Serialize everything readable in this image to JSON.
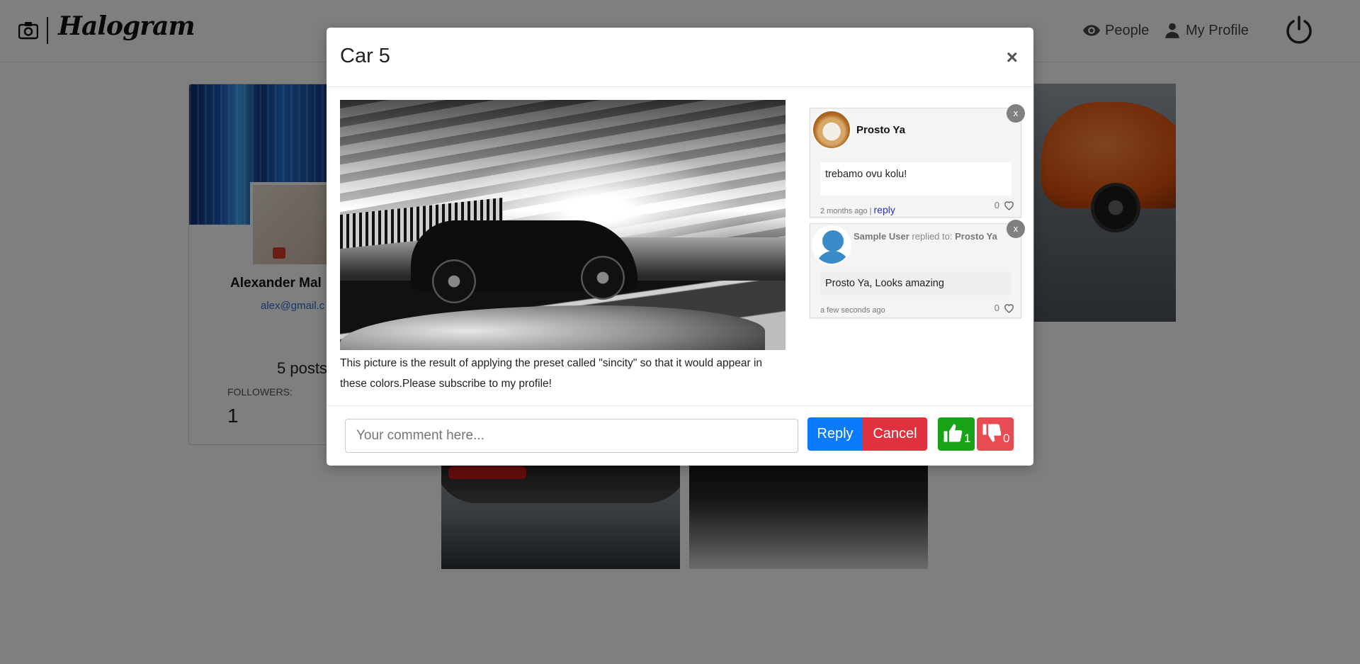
{
  "navbar": {
    "brand": "Halogram",
    "people_label": "People",
    "profile_label": "My Profile"
  },
  "profile": {
    "name": "Alexander Mal",
    "email": "alex@gmail.c",
    "posts": "5 posts",
    "followers_label": "FOLLOWERS:",
    "followers_value": "1"
  },
  "modal": {
    "title": "Car 5",
    "close_label": "×",
    "caption": "This picture is the result of applying the preset called \"sincity\" so that it would appear in these colors.Please subscribe to my profile!",
    "comments": [
      {
        "author": "Prosto Ya",
        "text": "trebamo ovu kolu!",
        "time": "2 months ago",
        "reply_label": "reply",
        "separator": "|",
        "likes": "0",
        "remove_label": "x"
      },
      {
        "author": "Sample User",
        "replied_to_label": "replied to:",
        "replied_to": "Prosto Ya",
        "text": "Prosto Ya, Looks amazing",
        "time": "a few seconds ago",
        "likes": "0",
        "remove_label": "x"
      }
    ],
    "footer": {
      "comment_placeholder": "Your comment here...",
      "reply_button": "Reply",
      "cancel_button": "Cancel",
      "like_count": "1",
      "dislike_count": "0"
    }
  },
  "colors": {
    "reply_button": "#0a7bfc",
    "cancel_button": "#e0313f",
    "like_button": "#19a317",
    "dislike_button": "#e84b51",
    "link": "#2d2fd8"
  },
  "icons": [
    "camera-icon",
    "eye-icon",
    "user-icon",
    "power-icon",
    "heart-icon",
    "thumbs-up-icon",
    "thumbs-down-icon",
    "close-icon"
  ]
}
